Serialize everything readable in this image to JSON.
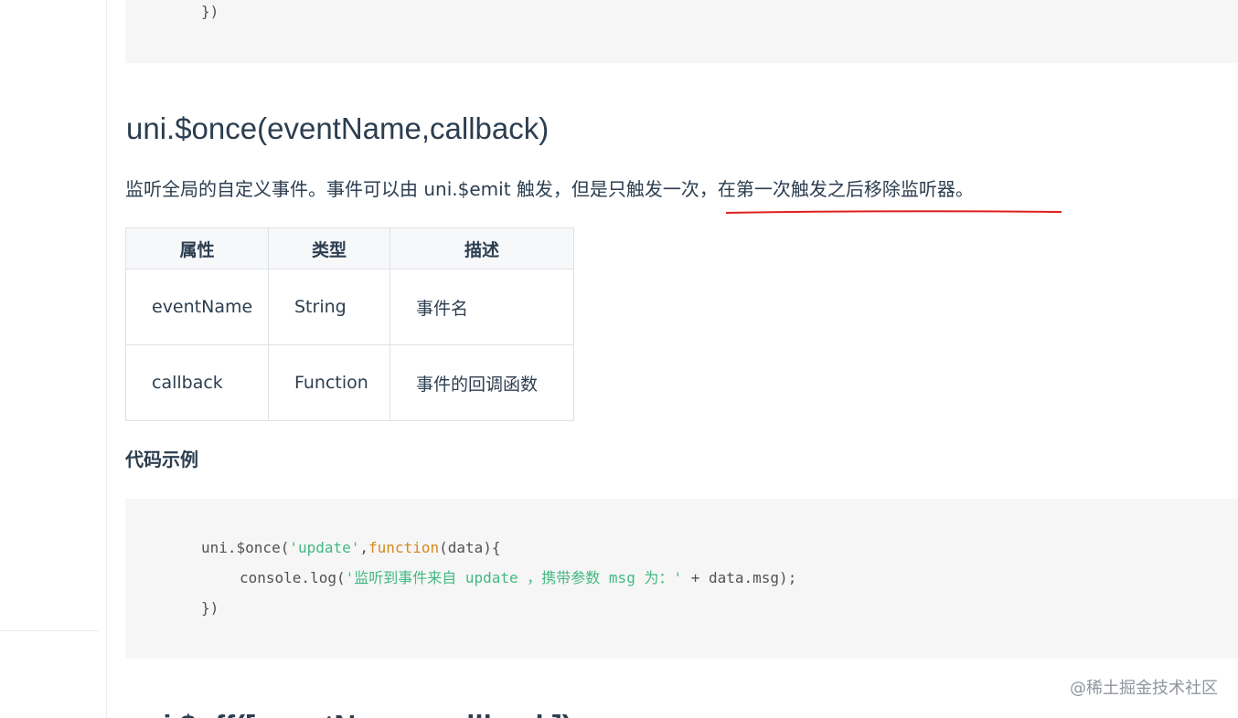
{
  "code_top": {
    "lines": [
      "})"
    ]
  },
  "heading": "uni.$once(eventName,callback)",
  "description": "监听全局的自定义事件。事件可以由 uni.$emit 触发，但是只触发一次，在第一次触发之后移除监听器。",
  "table": {
    "headers": [
      "属性",
      "类型",
      "描述"
    ],
    "rows": [
      [
        "eventName",
        "String",
        "事件名"
      ],
      [
        "callback",
        "Function",
        "事件的回调函数"
      ]
    ]
  },
  "code_example_title": "代码示例",
  "code_example": {
    "line1": {
      "a": "uni.$once(",
      "b": "'update'",
      "c": ",",
      "d": "function",
      "e": "(data){"
    },
    "line2": {
      "a": "console.log(",
      "b": "'监听到事件来自 update ，携带参数 msg 为：'",
      "c": " + data.msg);"
    },
    "line3": "})"
  },
  "next_heading": "uni.$off([eventName, callback])",
  "watermark": "@稀土掘金技术社区",
  "colors": {
    "underline": "#e02020",
    "code_string": "#42b983",
    "code_keyword": "#d38a1e",
    "code_background": "#f6f6f6"
  }
}
